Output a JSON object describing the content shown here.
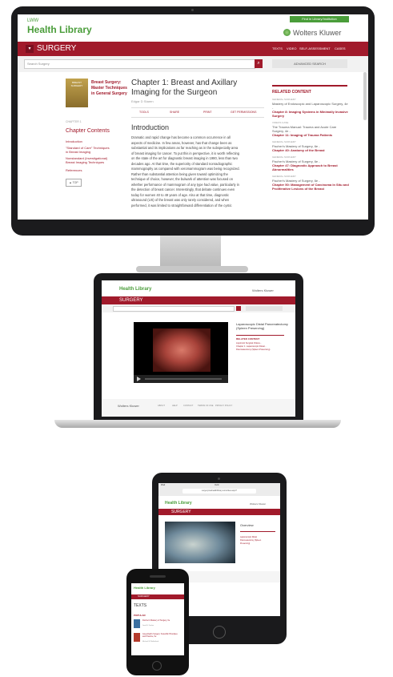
{
  "site": {
    "logo_small": "LWW",
    "logo": "Health Library",
    "publisher": "Wolters Kluwer",
    "top_link": "Find in Library/Institution",
    "section": "SURGERY",
    "nav": [
      "TEXTS",
      "VIDEO",
      "SELF-ASSESSMENT",
      "CASES"
    ],
    "search_placeholder": "Search Surgery",
    "advanced_search": "ADVANCED SEARCH"
  },
  "book": {
    "title_lines": [
      "Breast Surgery:",
      "Master Techniques",
      "in General Surgery"
    ],
    "cover_label": "BREAST SURGERY"
  },
  "chapter": {
    "title_lines": [
      "Chapter 1: Breast and Axillary",
      "Imaging for the Surgeon"
    ],
    "author": "Edgar D Staren",
    "tools": [
      "TOOLS",
      "SHARE",
      "PRINT",
      "GET PERMISSIONS"
    ],
    "pager": "CHAPTER 1",
    "section_heading": "Introduction",
    "body_lines": [
      "Dramatic and rapid change has become a common occurrence in all",
      "aspects of medicine. In few areas, however, has that change been as",
      "substantial and its implications as far reaching as in the subspecialty area",
      "of breast imaging for cancer. To put this in perspective, it is worth reflecting",
      "on the state of the art for diagnostic breast imaging in 1980, less than two",
      "decades ago. At that time, the superiority of standard nonradiographic",
      "mammography as compared with xeromammogram was being recognized.",
      "Rather than substantial attention being given toward optimizing the",
      "technique of choice, however, the bulwark of attention was focused on",
      "whether performance of mammogram of any type had value, particularly in",
      "the detection of breast cancer. Interestingly, that debate continues even",
      "today for women 40 to 49 years of age. Also at that time, diagnostic",
      "ultrasound (US) of the breast was only rarely considered, and when",
      "performed, it was limited to straightforward differentiation of the cystic"
    ]
  },
  "contents": {
    "heading": "Chapter Contents",
    "items": [
      "Introduction",
      "\"Standard of Care\" Techniques",
      "in Breast Imaging",
      "Nonstandard (Investigational)",
      "Breast Imaging Techniques",
      "References"
    ],
    "top_button": "▲ TOP"
  },
  "related": {
    "heading": "RELATED CONTENT",
    "items": [
      {
        "type": "GENERAL SURGERY",
        "source": "Mastery of Endoscopic and Laparoscopic Surgery, 4e -",
        "title": "Chapter 8: Imaging Systems in Minimally Invasive Surgery"
      },
      {
        "type": "VIDEOS CASE",
        "source": "The Trauma Manual: Trauma and Acute Care Surgery, 4e -",
        "title": "Chapter 11: Imaging of Trauma Patients"
      },
      {
        "type": "GENERAL SURGERY",
        "source": "Fischer's Mastery of Surgery, 6e -",
        "title": "Chapter 40: Anatomy of the Breast"
      },
      {
        "type": "GENERAL SURGERY",
        "source": "Fischer's Mastery of Surgery, 6e -",
        "title": "Chapter 47: Diagnostic Approach to Breast Abnormalities"
      },
      {
        "type": "GENERAL SURGERY",
        "source": "Fischer's Mastery of Surgery, 6e -",
        "title": "Chapter 50: Management of Carcinoma In Situ and Proliferative Lesions of the Breast"
      }
    ]
  },
  "laptop": {
    "video_title_lines": [
      "Laparoscopic Distal Pancreatectomy",
      "(Spleen Preserving)"
    ],
    "related_heading": "RELATED CONTENT",
    "related_lines": [
      "Lippincott Surgical Videos...",
      "Chapter 1: Laparoscopic Distal...",
      "Pancreatectomy (Spleen Preserving)"
    ],
    "footer": [
      "ABOUT",
      "HELP",
      "CONTACT",
      "TERMS OF USE",
      "PRIVACY POLICY"
    ]
  },
  "tablet": {
    "status_left": "iPad",
    "status_center": "Ovid",
    "url": "surgery.lwwhealthlibrary.com/video.aspx?",
    "title": "Overview",
    "related_lines": [
      "Laparoscopic Distal",
      "Pancreatectomy (Spleen",
      "Preserving)"
    ]
  },
  "phone": {
    "section": "SURGERY",
    "texts_heading": "TEXTS",
    "popular": "POPULAR",
    "items": [
      {
        "title": "Fischer's Mastery of Surgery, 6e",
        "desc": "Josef E. Fischer"
      },
      {
        "title": "Greenfield's Surgery: Scientific Principles and Practice, 5e",
        "desc": "Michael W. Mulholland"
      }
    ]
  },
  "colors": {
    "brand_red": "#a11a2b",
    "link_green": "#4a9d3a",
    "bezel": "#1a1a1c"
  },
  "icons": [
    "search-icon",
    "chevron-down-icon",
    "tools-icon",
    "share-icon",
    "print-icon",
    "permissions-icon",
    "play-icon",
    "home-button-icon",
    "camera-icon"
  ]
}
